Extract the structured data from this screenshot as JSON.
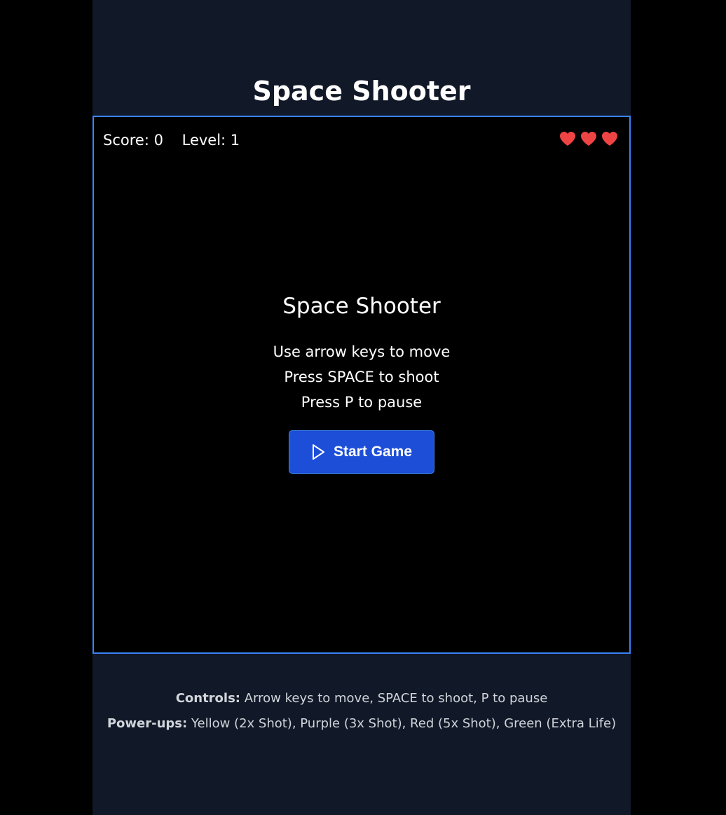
{
  "app": {
    "title": "Space Shooter"
  },
  "hud": {
    "score_text": "Score: 0",
    "level_text": "Level: 1",
    "lives": 3,
    "heart_color": "#ef4444"
  },
  "overlay": {
    "title": "Space Shooter",
    "instructions": [
      "Use arrow keys to move",
      "Press SPACE to shoot",
      "Press P to pause"
    ],
    "start_label": "Start Game",
    "start_icon": "play-icon",
    "button_color": "#1d4ed8"
  },
  "help": {
    "controls_label": "Controls:",
    "controls_text": " Arrow keys to move, SPACE to shoot, P to pause",
    "powerups_label": "Power-ups:",
    "powerups_text": " Yellow (2x Shot), Purple (3x Shot), Red (5x Shot), Green (Extra Life)"
  },
  "colors": {
    "page_background": "#111827",
    "frame_border": "#3b82f6",
    "canvas_background": "#000000"
  }
}
